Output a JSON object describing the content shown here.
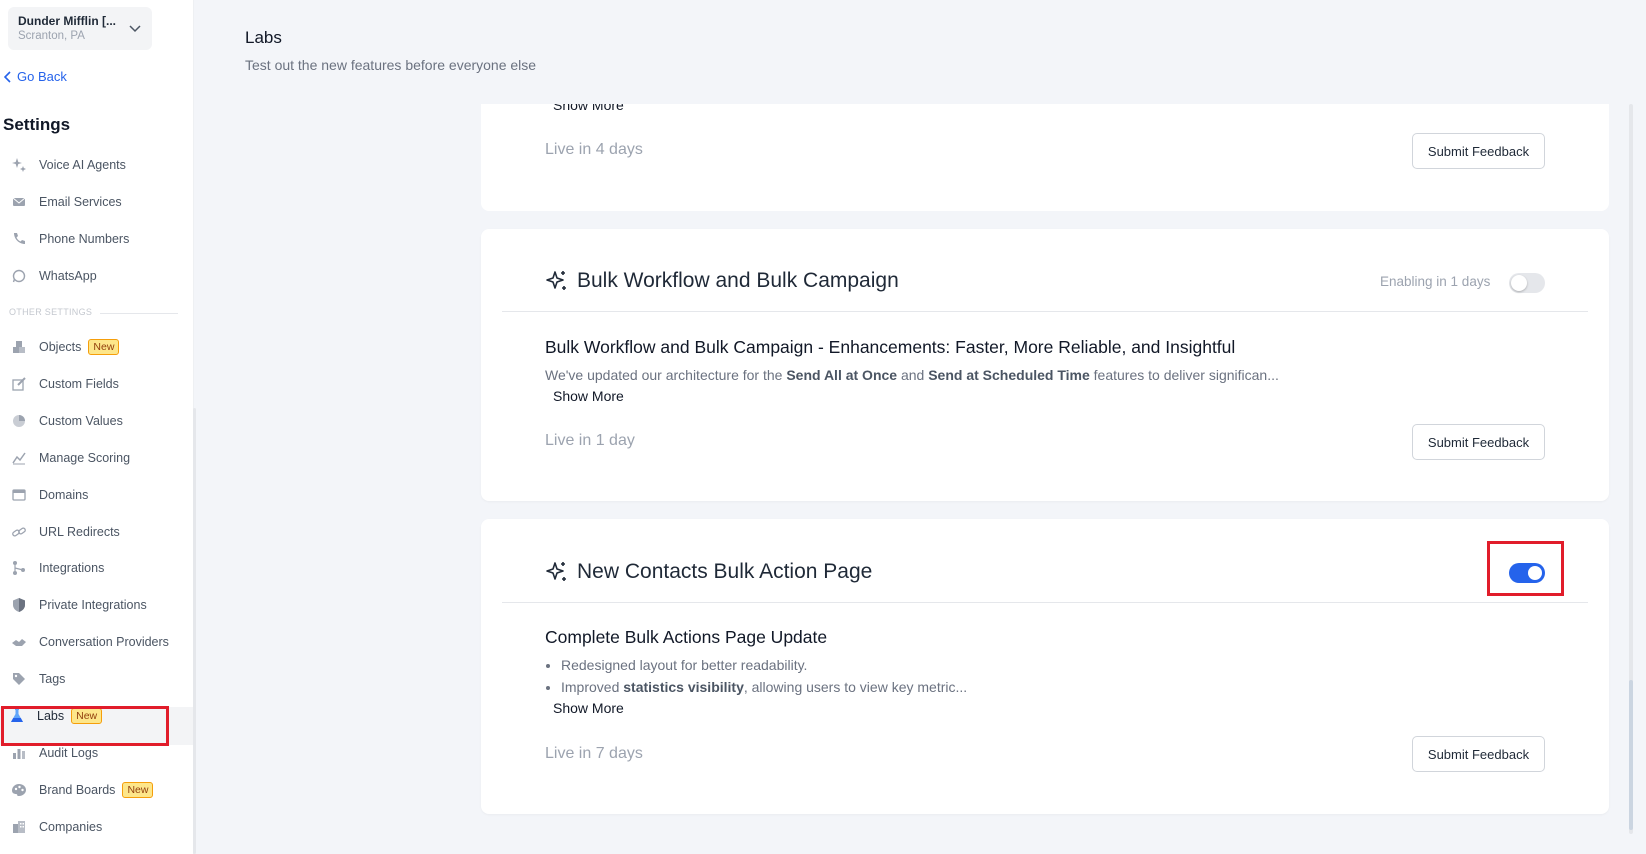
{
  "account": {
    "name": "Dunder Mifflin [...",
    "location": "Scranton, PA"
  },
  "nav": {
    "go_back": "Go Back",
    "settings_title": "Settings",
    "section_other": "OTHER SETTINGS",
    "badge_new": "New",
    "items": [
      {
        "label": "Voice AI Agents",
        "icon": "sparkle-icon"
      },
      {
        "label": "Email Services",
        "icon": "mail-icon"
      },
      {
        "label": "Phone Numbers",
        "icon": "phone-icon"
      },
      {
        "label": "WhatsApp",
        "icon": "whatsapp-icon"
      },
      {
        "label": "Objects",
        "icon": "objects-icon"
      },
      {
        "label": "Custom Fields",
        "icon": "edit-icon"
      },
      {
        "label": "Custom Values",
        "icon": "pie-icon"
      },
      {
        "label": "Manage Scoring",
        "icon": "chart-icon"
      },
      {
        "label": "Domains",
        "icon": "browser-icon"
      },
      {
        "label": "URL Redirects",
        "icon": "link-icon"
      },
      {
        "label": "Integrations",
        "icon": "integration-icon"
      },
      {
        "label": "Private Integrations",
        "icon": "shield-icon"
      },
      {
        "label": "Conversation Providers",
        "icon": "handshake-icon"
      },
      {
        "label": "Tags",
        "icon": "tag-icon"
      },
      {
        "label": "Labs",
        "icon": "flask-icon"
      },
      {
        "label": "Audit Logs",
        "icon": "bar-chart-icon"
      },
      {
        "label": "Brand Boards",
        "icon": "palette-icon"
      },
      {
        "label": "Companies",
        "icon": "building-icon"
      }
    ]
  },
  "header": {
    "title": "Labs",
    "subtitle": "Test out the new features before everyone else"
  },
  "cards": [
    {
      "show_more": "Show More",
      "live": "Live in 4 days",
      "feedback": "Submit Feedback"
    },
    {
      "title": "Bulk Workflow and Bulk Campaign",
      "enabling": "Enabling in 1 days",
      "toggle_on": false,
      "heading": "Bulk Workflow and Bulk Campaign - Enhancements: Faster, More Reliable, and Insightful",
      "desc_prefix": "We've updated our architecture for the ",
      "desc_bold1": "Send All at Once",
      "desc_mid": " and ",
      "desc_bold2": "Send at Scheduled Time",
      "desc_suffix": " features to deliver significan...",
      "show_more": "Show More",
      "live": "Live in 1 day",
      "feedback": "Submit Feedback"
    },
    {
      "title": "New Contacts Bulk Action Page",
      "toggle_on": true,
      "heading": "Complete Bulk Actions Page Update",
      "bullet1": "Redesigned layout for better readability.",
      "bullet2_prefix": "Improved ",
      "bullet2_bold": "statistics visibility",
      "bullet2_suffix": ", allowing users to view key metric...",
      "show_more": "Show More",
      "live": "Live in 7 days",
      "feedback": "Submit Feedback"
    }
  ],
  "colors": {
    "accent": "#2563eb",
    "highlight": "#e11d2a",
    "badge_bg": "#fde68a"
  }
}
